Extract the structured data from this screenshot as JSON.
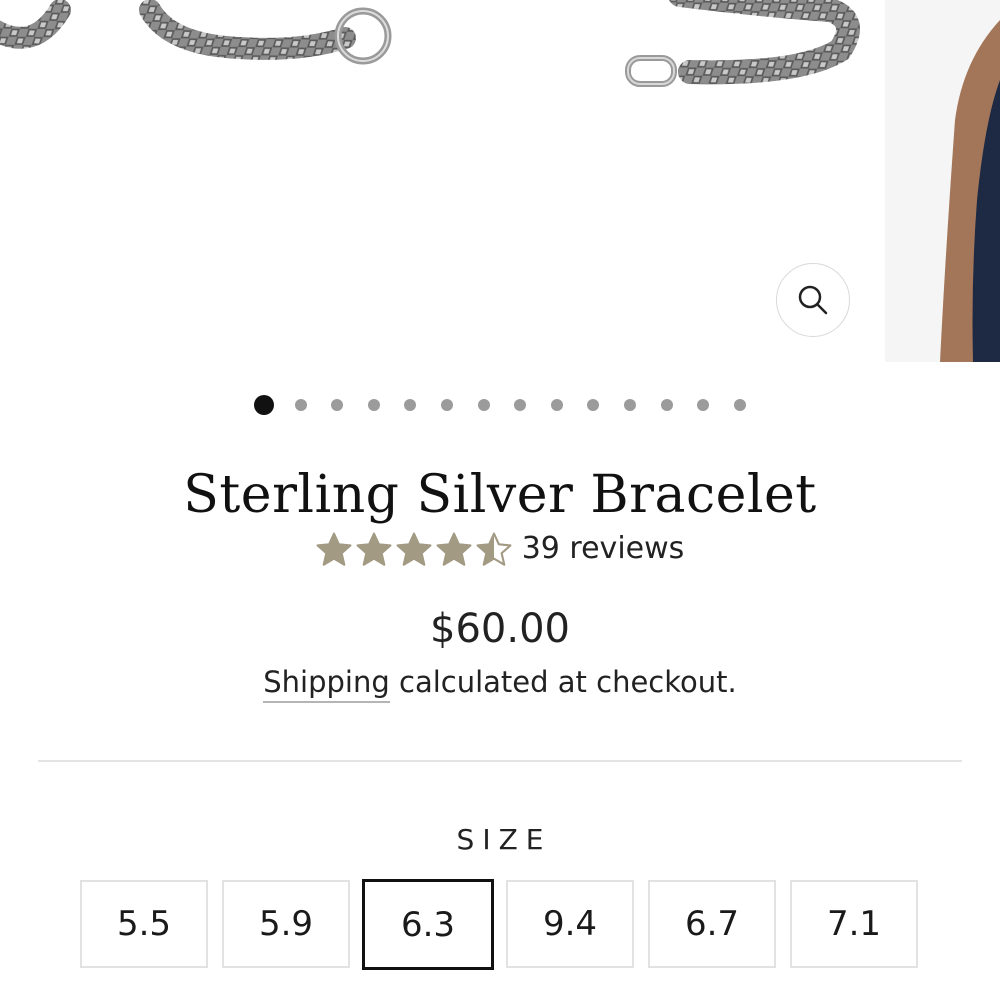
{
  "product": {
    "title": "Sterling Silver Bracelet",
    "rating": 4.5,
    "rating_max": 5,
    "reviews_label": "39 reviews",
    "price": "$60.00",
    "shipping_link": "Shipping",
    "shipping_text": " calculated at checkout."
  },
  "gallery": {
    "slide_count": 14,
    "active_slide": 1,
    "zoom_icon": "search-icon"
  },
  "size": {
    "label": "SIZE",
    "options": [
      "5.5",
      "5.9",
      "6.3",
      "9.4",
      "6.7",
      "7.1"
    ],
    "selected": "6.3"
  },
  "colors": {
    "star": "#a39a83",
    "text": "#222222",
    "active_dot": "#111111",
    "inactive_dot": "#9b9b9b",
    "selected_border": "#111111",
    "option_border": "#e2e2e2"
  }
}
